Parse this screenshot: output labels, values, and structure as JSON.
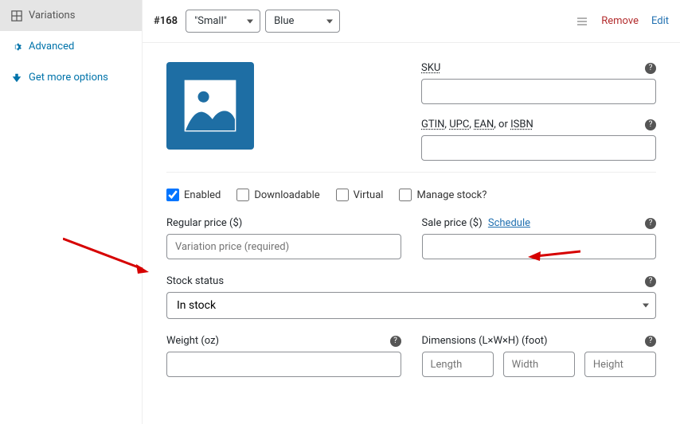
{
  "sidebar": {
    "items": [
      {
        "label": "Variations"
      },
      {
        "label": "Advanced"
      },
      {
        "label": "Get more options"
      }
    ]
  },
  "variation": {
    "id_label": "#168",
    "attr1": "\"Small\"",
    "attr2": "Blue",
    "remove_label": "Remove",
    "edit_label": "Edit"
  },
  "fields": {
    "sku_label": "SKU",
    "gtin_label_part1": "GTIN",
    "gtin_label_part2": "UPC",
    "gtin_label_part3": "EAN",
    "gtin_label_sep": ", ",
    "gtin_label_or": ", or ",
    "gtin_label_part4": "ISBN"
  },
  "checkboxes": {
    "enabled": "Enabled",
    "downloadable": "Downloadable",
    "virtual": "Virtual",
    "manage_stock": "Manage stock?"
  },
  "price": {
    "regular_label": "Regular price ($)",
    "regular_placeholder": "Variation price (required)",
    "sale_label": "Sale price ($)",
    "schedule_label": "Schedule"
  },
  "stock": {
    "label": "Stock status",
    "value": "In stock"
  },
  "weight": {
    "label": "Weight (oz)"
  },
  "dimensions": {
    "label": "Dimensions (L×W×H) (foot)",
    "length_ph": "Length",
    "width_ph": "Width",
    "height_ph": "Height"
  }
}
